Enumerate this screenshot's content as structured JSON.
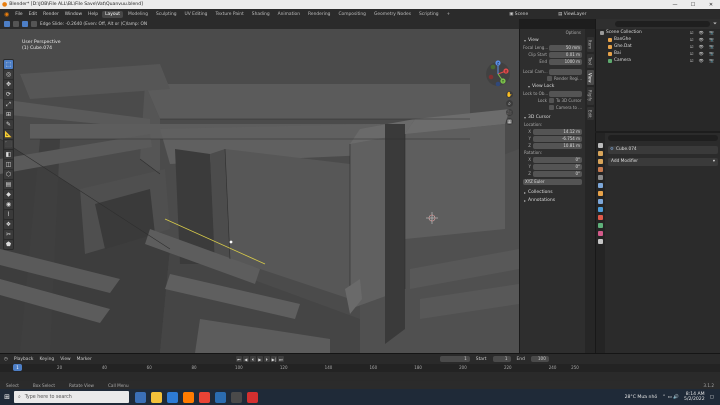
{
  "window": {
    "title": "Blender* [D:\\JOB\\File ALL\\BL\\File Save\\Vat\\Quanvuu.blend]",
    "min": "—",
    "max": "☐",
    "close": "✕"
  },
  "menu": {
    "items": [
      "File",
      "Edit",
      "Render",
      "Window",
      "Help"
    ],
    "workspaces": [
      "Layout",
      "Modeling",
      "Sculpting",
      "UV Editing",
      "Texture Paint",
      "Shading",
      "Animation",
      "Rendering",
      "Compositing",
      "Geometry Nodes",
      "Scripting",
      "+"
    ],
    "active_workspace": "Layout",
    "scene_label": "Scene",
    "viewlayer_label": "ViewLayer"
  },
  "viewport": {
    "header_text": "Edge Slide: -0.2640 (Even: Off, Alt or (C)lamp: ON",
    "overlay_line1": "User Perspective",
    "overlay_line2": "(1) Cube.074",
    "gizmo": {
      "x": "X",
      "y": "Y",
      "z": "Z"
    },
    "nav_buttons": [
      "✋",
      "⌕",
      "🎥",
      "▦"
    ]
  },
  "tools": [
    "⬚",
    "◎",
    "✥",
    "⟳",
    "⤢",
    "⊞",
    "✎",
    "📐",
    "⬛",
    "◧",
    "◫",
    "⬡",
    "▤",
    "◆",
    "◉",
    "⌇",
    "❖",
    "✂",
    "⬟"
  ],
  "npanel": {
    "options": "Options",
    "view_title": "View",
    "focal_label": "Focal Leng...",
    "focal_value": "50 mm",
    "clip_start_label": "Clip Start",
    "clip_start_value": "0.01 m",
    "clip_end_label": "End",
    "clip_end_value": "1000 m",
    "local_cam_label": "Local Cam...",
    "render_region": "Render Regi...",
    "view_lock_title": "View Lock",
    "lock_to_obj_label": "Lock to Ob...",
    "lock_label": "Lock",
    "to_3d_cursor": "To 3D Cursor",
    "camera_to": "Camera to ...",
    "cursor_title": "3D Cursor",
    "location_label": "Location:",
    "loc_x": "14.12 m",
    "loc_y": "-6.754 m",
    "loc_z": "10.81 m",
    "rotation_label": "Rotation:",
    "rot_x": "0°",
    "rot_y": "0°",
    "rot_z": "0°",
    "rot_mode": "XYZ Euler",
    "collections": "Collections",
    "annotations": "Annotations",
    "axis_x": "X",
    "axis_y": "Y",
    "axis_z": "Z"
  },
  "vtabs": [
    "Item",
    "Tool",
    "View",
    "Rigify",
    "Edit"
  ],
  "outliner": {
    "rows": [
      {
        "name": "Scene Collection",
        "color": "#9a9a9a",
        "indent": 0
      },
      {
        "name": "BanGhe",
        "color": "#e8a34a",
        "indent": 1
      },
      {
        "name": "Ghe.Dat",
        "color": "#e8a34a",
        "indent": 1
      },
      {
        "name": "Bai",
        "color": "#e8a34a",
        "indent": 1
      },
      {
        "name": "Camera",
        "color": "#5ea96e",
        "indent": 1
      }
    ],
    "vis": "☑ 👁 📷"
  },
  "properties": {
    "object": "Cube.074",
    "add_modifier": "Add Modifier",
    "tab_colors": [
      "#bbbbbb",
      "#d9a55a",
      "#d9a55a",
      "#c77a4f",
      "#8a8a8a",
      "#7da7d9",
      "#e8a34a",
      "#7da7d9",
      "#4d9dd9",
      "#e15a4a",
      "#5fb07a",
      "#d35a8a",
      "#c5c5c5"
    ]
  },
  "timeline": {
    "menus": [
      "Playback",
      "Keying",
      "View",
      "Marker"
    ],
    "controls": [
      "⏮",
      "◀",
      "⏴",
      "▶",
      "⏵",
      "▶|",
      "⏭"
    ],
    "current_frame": "1",
    "start_label": "Start",
    "start": "1",
    "end_label": "End",
    "end": "100",
    "ticks": [
      "1",
      "20",
      "40",
      "60",
      "80",
      "100",
      "120",
      "140",
      "160",
      "180",
      "200",
      "220",
      "240",
      "250"
    ]
  },
  "statusbar": {
    "items": [
      "Select",
      "Box Select",
      "Rotate View",
      "Call Menu"
    ],
    "version": "3.1.2"
  },
  "taskbar": {
    "search": "Type here to search",
    "weather": "28°C  Mưa nhỏ",
    "time": "8:14 AM",
    "date": "5/2/2022",
    "app_colors": [
      "#3b6fb6",
      "#f3c13a",
      "#2d7bd6",
      "#ff7b00",
      "#ea4335",
      "#2b6cb0",
      "#4a4a4a",
      "#d32f2f"
    ]
  }
}
